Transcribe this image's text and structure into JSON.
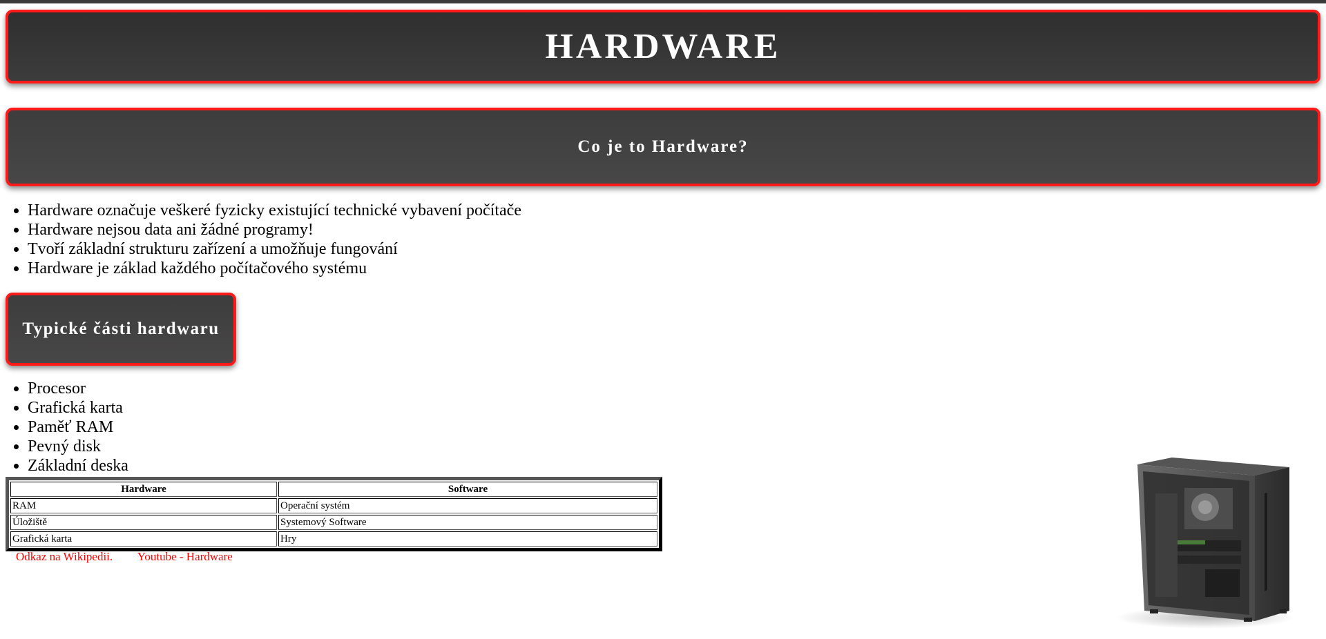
{
  "header": {
    "title": "HARDWARE"
  },
  "section1": {
    "title": "Co je to Hardware?",
    "items": [
      "Hardware označuje veškeré fyzicky existující technické vybavení počítače",
      "Hardware nejsou data ani žádné programy!",
      "Tvoří základní strukturu zařízení a umožňuje fungování",
      "Hardware je základ každého počítačového systému"
    ]
  },
  "section2": {
    "title": "Typické části hardwaru",
    "items": [
      "Procesor",
      "Grafická karta",
      "Paměť RAM",
      "Pevný disk",
      "Základní deska"
    ]
  },
  "table": {
    "headers": [
      "Hardware",
      "Software"
    ],
    "rows": [
      [
        "RAM",
        "Operační systém"
      ],
      [
        "Úložiště",
        "Systemový Software"
      ],
      [
        "Grafická karta",
        "Hry"
      ]
    ]
  },
  "links": [
    {
      "label": "Odkaz na Wikipedii."
    },
    {
      "label": "Youtube - Hardware"
    }
  ],
  "image": {
    "icon": "pc-case-icon"
  },
  "colors": {
    "accent": "#ff1a1a",
    "box_bg": "#3c3c3c",
    "link": "#ff0000"
  }
}
